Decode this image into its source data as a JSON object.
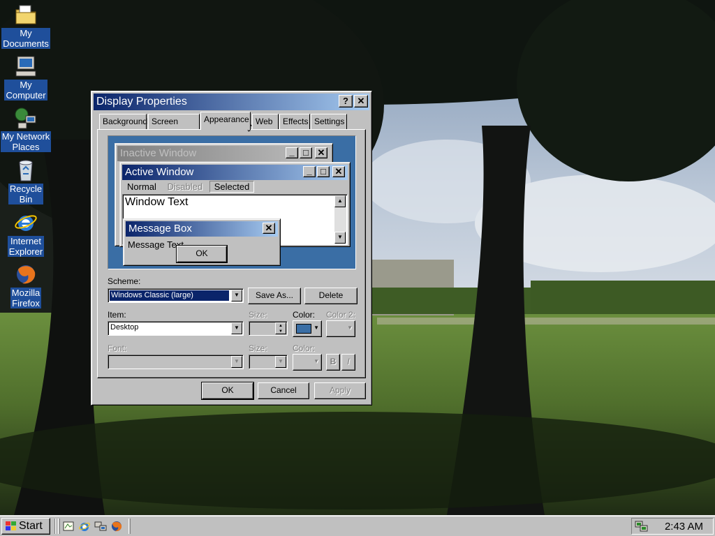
{
  "desktop": {
    "icons": [
      {
        "label": "My\nDocuments",
        "icon": "my-documents-icon"
      },
      {
        "label": "My\nComputer",
        "icon": "my-computer-icon"
      },
      {
        "label": "My Network\nPlaces",
        "icon": "network-places-icon"
      },
      {
        "label": "Recycle\nBin",
        "icon": "recycle-bin-icon"
      },
      {
        "label": "Internet\nExplorer",
        "icon": "internet-explorer-icon"
      },
      {
        "label": "Mozilla\nFirefox",
        "icon": "firefox-icon"
      }
    ]
  },
  "dialog": {
    "title": "Display Properties",
    "help_button": "?",
    "close_button": "✕",
    "tabs": [
      "Background",
      "Screen Saver",
      "Appearance",
      "Web",
      "Effects",
      "Settings"
    ],
    "active_tab": "Appearance",
    "preview": {
      "inactive_title": "Inactive Window",
      "active_title": "Active Window",
      "menu": {
        "normal": "Normal",
        "disabled": "Disabled",
        "selected": "Selected"
      },
      "window_text": "Window Text",
      "message_title": "Message Box",
      "message_text": "Message Text",
      "ok_label": "OK"
    },
    "scheme_label": "Scheme:",
    "scheme_value": "Windows Classic (large)",
    "save_as_label": "Save As...",
    "delete_label": "Delete",
    "item_label": "Item:",
    "item_value": "Desktop",
    "size_label": "Size:",
    "color_label": "Color:",
    "color2_label": "Color 2:",
    "font_label": "Font:",
    "font_size_label": "Size:",
    "font_color_label": "Color:",
    "bold_label": "B",
    "italic_label": "I",
    "ok_label": "OK",
    "cancel_label": "Cancel",
    "apply_label": "Apply",
    "selected_color": "#3a6ea5"
  },
  "taskbar": {
    "start_label": "Start",
    "clock": "2:43 AM",
    "quick_launch": [
      "show-desktop-icon",
      "internet-explorer-icon",
      "network-icon",
      "firefox-icon"
    ]
  }
}
